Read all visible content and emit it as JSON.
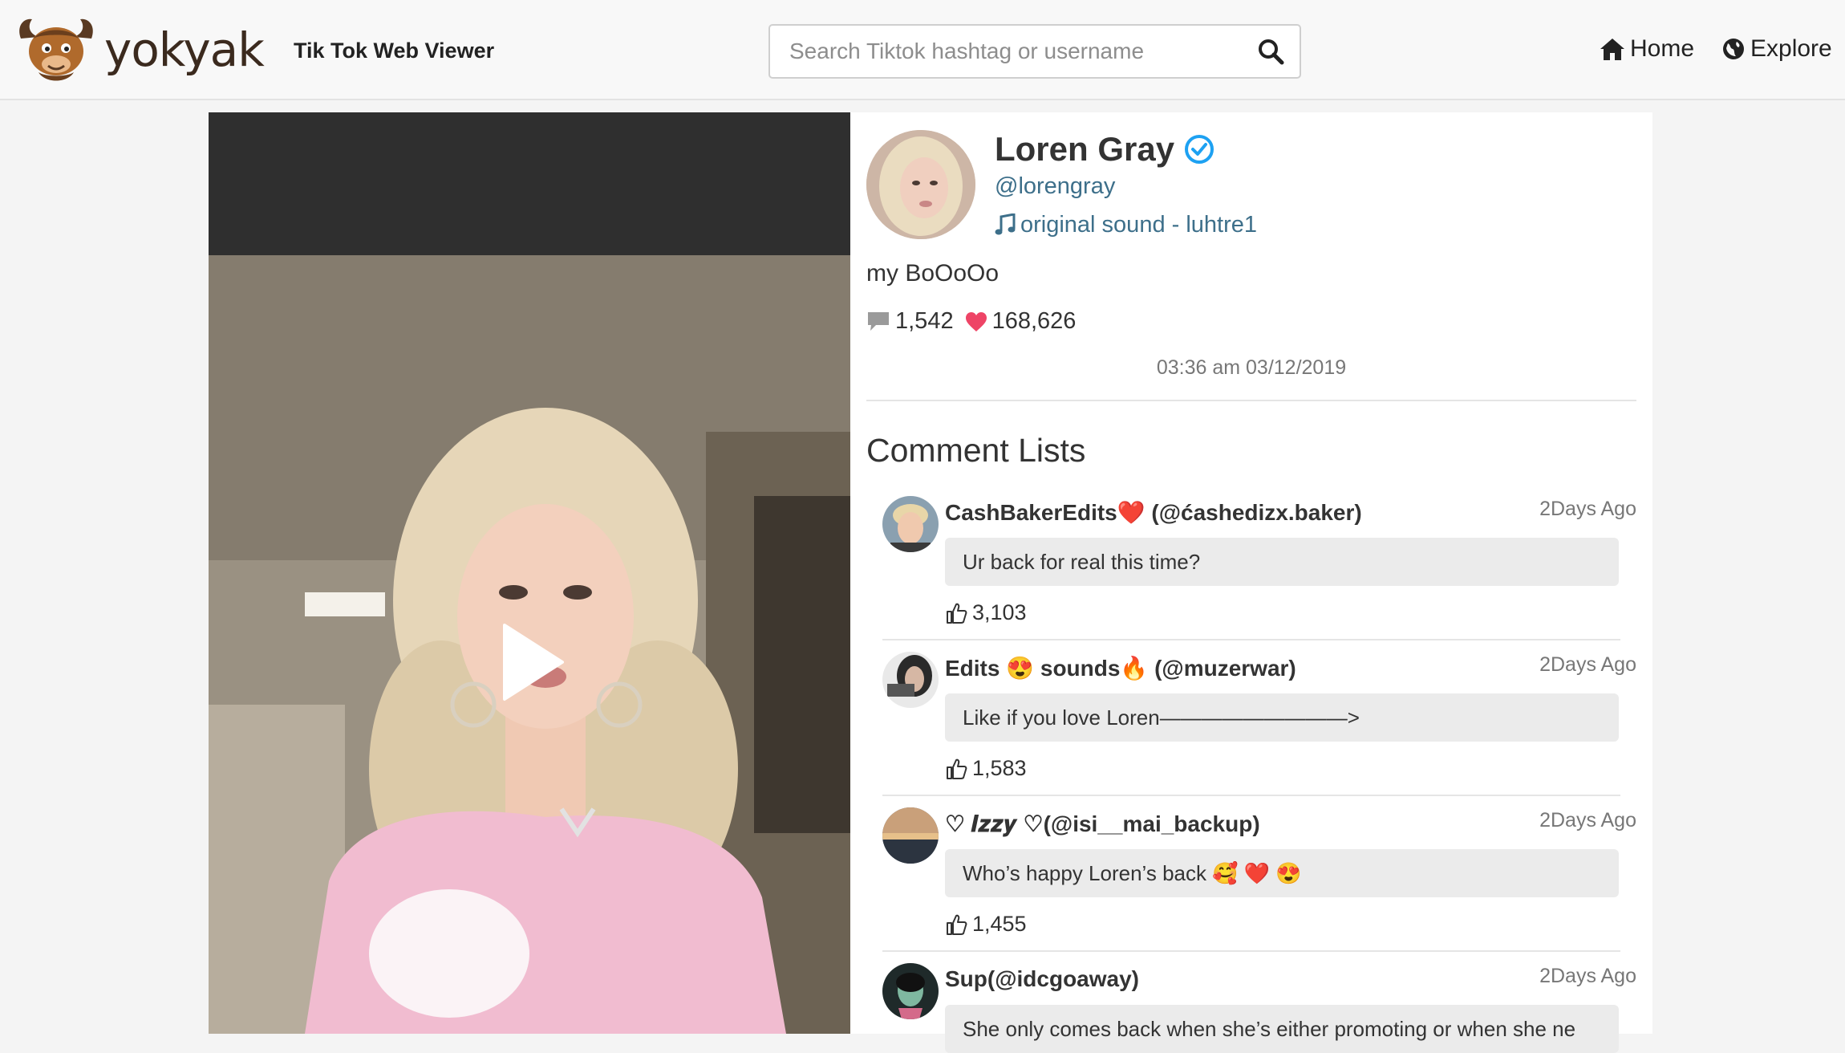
{
  "brand": {
    "name": "yokyak",
    "tagline": "Tik Tok Web Viewer"
  },
  "search": {
    "placeholder": "Search Tiktok hashtag or username"
  },
  "nav": {
    "home_label": "Home",
    "explore_label": "Explore"
  },
  "post": {
    "name": "Loren Gray",
    "handle": "@lorengray",
    "sound": "original sound - luhtre1",
    "caption": "my BoOoOo",
    "comment_count": "1,542",
    "like_count": "168,626",
    "timestamp": "03:36 am 03/12/2019"
  },
  "comments_title": "Comment Lists",
  "comments": [
    {
      "author": "CashBakerEdits❤️ (@ćashedizx.baker)",
      "time": "2Days Ago",
      "text": "Ur back for real this time?",
      "likes": "3,103"
    },
    {
      "author": "Edits 😍  sounds🔥 (@muzerwar)",
      "time": "2Days Ago",
      "text": "Like if you love Loren—————————>",
      "likes": "1,583"
    },
    {
      "author": "♡ 𝑰𝒛𝒛𝒚 ♡(@isi__mai_backup)",
      "time": "2Days Ago",
      "text": "Who’s happy Loren’s back 🥰 ❤️ 😍",
      "likes": "1,455"
    },
    {
      "author": "Sup(@idcgoaway)",
      "time": "2Days Ago",
      "text": "She only comes back when she’s either promoting or when she ne",
      "likes": ""
    }
  ],
  "colors": {
    "link": "#3d6f8a",
    "verified": "#1da1f2",
    "heart": "#ee4466",
    "navbar_bg": "#f8f8f8",
    "bubble_bg": "#ebebeb"
  },
  "icons": {
    "logo": "yak-head-icon",
    "search": "search-icon",
    "home": "home-icon",
    "explore": "globe-icon",
    "verified": "verified-check-icon",
    "sound": "music-note-icon",
    "comments": "comment-bubble-icon",
    "likes": "heart-icon",
    "comment_like": "thumbs-up-icon",
    "play": "play-icon"
  }
}
